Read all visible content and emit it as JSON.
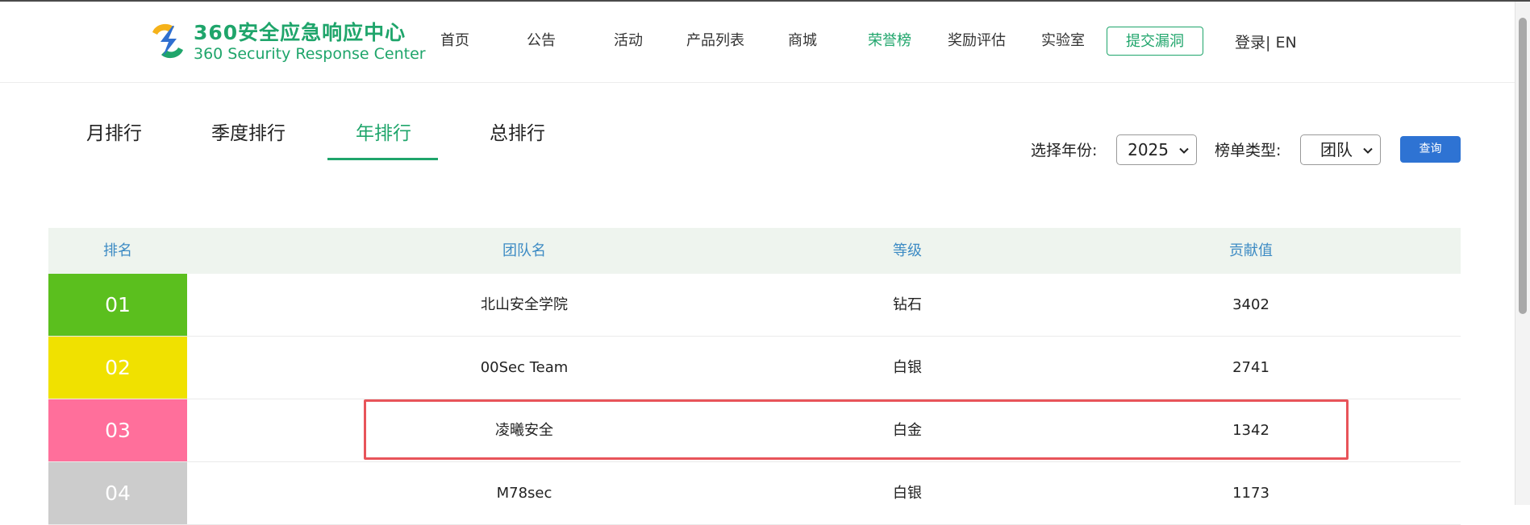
{
  "logo": {
    "title_cn": "360安全应急响应中心",
    "title_en": "360 Security Response Center",
    "colors": {
      "green": "#1fa56b",
      "yellow": "#f5b21a",
      "blue": "#2f6fd0"
    }
  },
  "nav": {
    "items": [
      {
        "label": "首页",
        "active": false
      },
      {
        "label": "公告",
        "active": false
      },
      {
        "label": "活动",
        "active": false
      },
      {
        "label": "产品列表",
        "active": false
      },
      {
        "label": "商城",
        "active": false
      },
      {
        "label": "荣誉榜",
        "active": true
      },
      {
        "label": "奖励评估",
        "active": false
      },
      {
        "label": "实验室",
        "active": false
      }
    ],
    "submit_label": "提交漏洞",
    "login_label": "登录| EN"
  },
  "tabs": [
    {
      "label": "月排行",
      "active": false
    },
    {
      "label": "季度排行",
      "active": false
    },
    {
      "label": "年排行",
      "active": true
    },
    {
      "label": "总排行",
      "active": false
    }
  ],
  "filters": {
    "year_label": "选择年份:",
    "year_value": "2025",
    "type_label": "榜单类型:",
    "type_value": "团队",
    "query_label": "查询"
  },
  "table": {
    "headers": {
      "rank": "排名",
      "team": "团队名",
      "level": "等级",
      "score": "贡献值"
    },
    "rows": [
      {
        "rank": "01",
        "team": "北山安全学院",
        "level": "钻石",
        "score": "3402",
        "color": "#5bbf1e"
      },
      {
        "rank": "02",
        "team": "00Sec Team",
        "level": "白银",
        "score": "2741",
        "color": "#f0e100"
      },
      {
        "rank": "03",
        "team": "凌曦安全",
        "level": "白金",
        "score": "1342",
        "color": "#ff6f9b"
      },
      {
        "rank": "04",
        "team": "M78sec",
        "level": "白银",
        "score": "1173",
        "color": "#cccccc"
      }
    ]
  },
  "colors": {
    "accent_green": "#1fa56b",
    "query_blue": "#2e73d3",
    "header_blue": "#3d8bc4",
    "highlight_red": "#e8545a"
  }
}
